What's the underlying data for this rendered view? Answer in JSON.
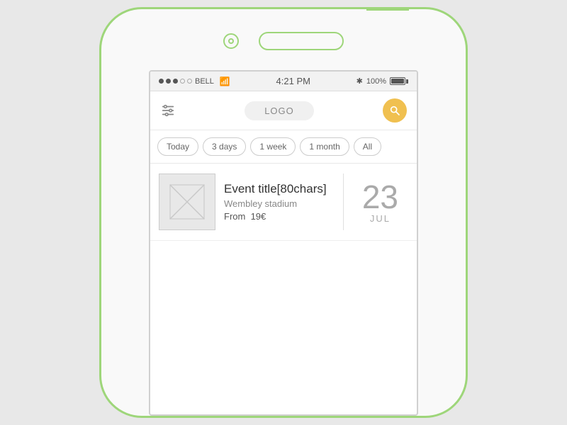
{
  "phone": {
    "status_bar": {
      "carrier": "BELL",
      "signal_bars": 3,
      "signal_empty": 2,
      "time": "4:21 PM",
      "bluetooth": "✱",
      "battery_percent": "100%"
    },
    "navbar": {
      "logo_label": "LOGO",
      "filter_icon_name": "filter-icon",
      "search_icon_name": "search-icon"
    },
    "filter_tabs": [
      {
        "label": "Today",
        "id": "tab-today"
      },
      {
        "label": "3 days",
        "id": "tab-3days"
      },
      {
        "label": "1 week",
        "id": "tab-1week"
      },
      {
        "label": "1 month",
        "id": "tab-1month"
      },
      {
        "label": "All",
        "id": "tab-all"
      }
    ],
    "events": [
      {
        "title": "Event title[80chars]",
        "venue": "Wembley stadium",
        "price_label": "From",
        "price_value": "19€",
        "day": "23",
        "month": "JUL"
      }
    ]
  }
}
